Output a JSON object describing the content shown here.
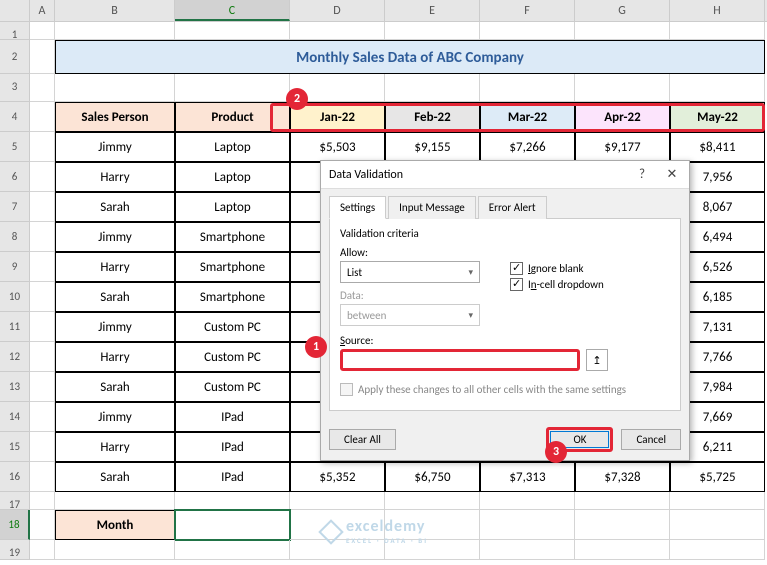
{
  "columns": [
    "A",
    "B",
    "C",
    "D",
    "E",
    "F",
    "G",
    "H"
  ],
  "title": "Monthly Sales Data of ABC Company",
  "headers": {
    "sales_person": "Sales Person",
    "product": "Product",
    "months": [
      "Jan-22",
      "Feb-22",
      "Mar-22",
      "Apr-22",
      "May-22"
    ]
  },
  "rows": [
    {
      "n": 5,
      "person": "Jimmy",
      "product": "Laptop",
      "vals": [
        "$5,503",
        "$9,155",
        "$7,266",
        "$9,177",
        "$8,411"
      ]
    },
    {
      "n": 6,
      "person": "Harry",
      "product": "Laptop",
      "vals": [
        "",
        "",
        "",
        "",
        "7,956"
      ]
    },
    {
      "n": 7,
      "person": "Sarah",
      "product": "Laptop",
      "vals": [
        "",
        "",
        "",
        "",
        "8,067"
      ]
    },
    {
      "n": 8,
      "person": "Jimmy",
      "product": "Smartphone",
      "vals": [
        "",
        "",
        "",
        "",
        "6,494"
      ]
    },
    {
      "n": 9,
      "person": "Harry",
      "product": "Smartphone",
      "vals": [
        "",
        "",
        "",
        "",
        "6,526"
      ]
    },
    {
      "n": 10,
      "person": "Sarah",
      "product": "Smartphone",
      "vals": [
        "",
        "",
        "",
        "",
        "6,185"
      ]
    },
    {
      "n": 11,
      "person": "Jimmy",
      "product": "Custom PC",
      "vals": [
        "",
        "",
        "",
        "",
        "7,131"
      ]
    },
    {
      "n": 12,
      "person": "Harry",
      "product": "Custom PC",
      "vals": [
        "",
        "",
        "",
        "",
        "7,766"
      ]
    },
    {
      "n": 13,
      "person": "Sarah",
      "product": "Custom PC",
      "vals": [
        "",
        "",
        "",
        "",
        "7,984"
      ]
    },
    {
      "n": 14,
      "person": "Jimmy",
      "product": "IPad",
      "vals": [
        "",
        "",
        "",
        "",
        "7,669"
      ]
    },
    {
      "n": 15,
      "person": "Harry",
      "product": "IPad",
      "vals": [
        "",
        "",
        "",
        "",
        "6,211"
      ]
    },
    {
      "n": 16,
      "person": "Sarah",
      "product": "IPad",
      "vals": [
        "$5,352",
        "$6,750",
        "$7,313",
        "$7,328",
        "$5,725"
      ]
    }
  ],
  "month_label": "Month",
  "dialog": {
    "title": "Data Validation",
    "help": "?",
    "close": "✕",
    "tabs": [
      "Settings",
      "Input Message",
      "Error Alert"
    ],
    "criteria_label": "Validation criteria",
    "allow_label": "Allow:",
    "allow_value": "List",
    "data_label": "Data:",
    "data_value": "between",
    "ignore_blank": "Ignore blank",
    "incell_dd": "In-cell dropdown",
    "source_label": "Source:",
    "apply_label": "Apply these changes to all other cells with the same settings",
    "clear_all": "Clear All",
    "ok": "OK",
    "cancel": "Cancel"
  },
  "callouts": {
    "c1": "1",
    "c2": "2",
    "c3": "3"
  },
  "watermark": {
    "name": "exceldemy",
    "sub": "EXCEL · DATA · BI"
  }
}
